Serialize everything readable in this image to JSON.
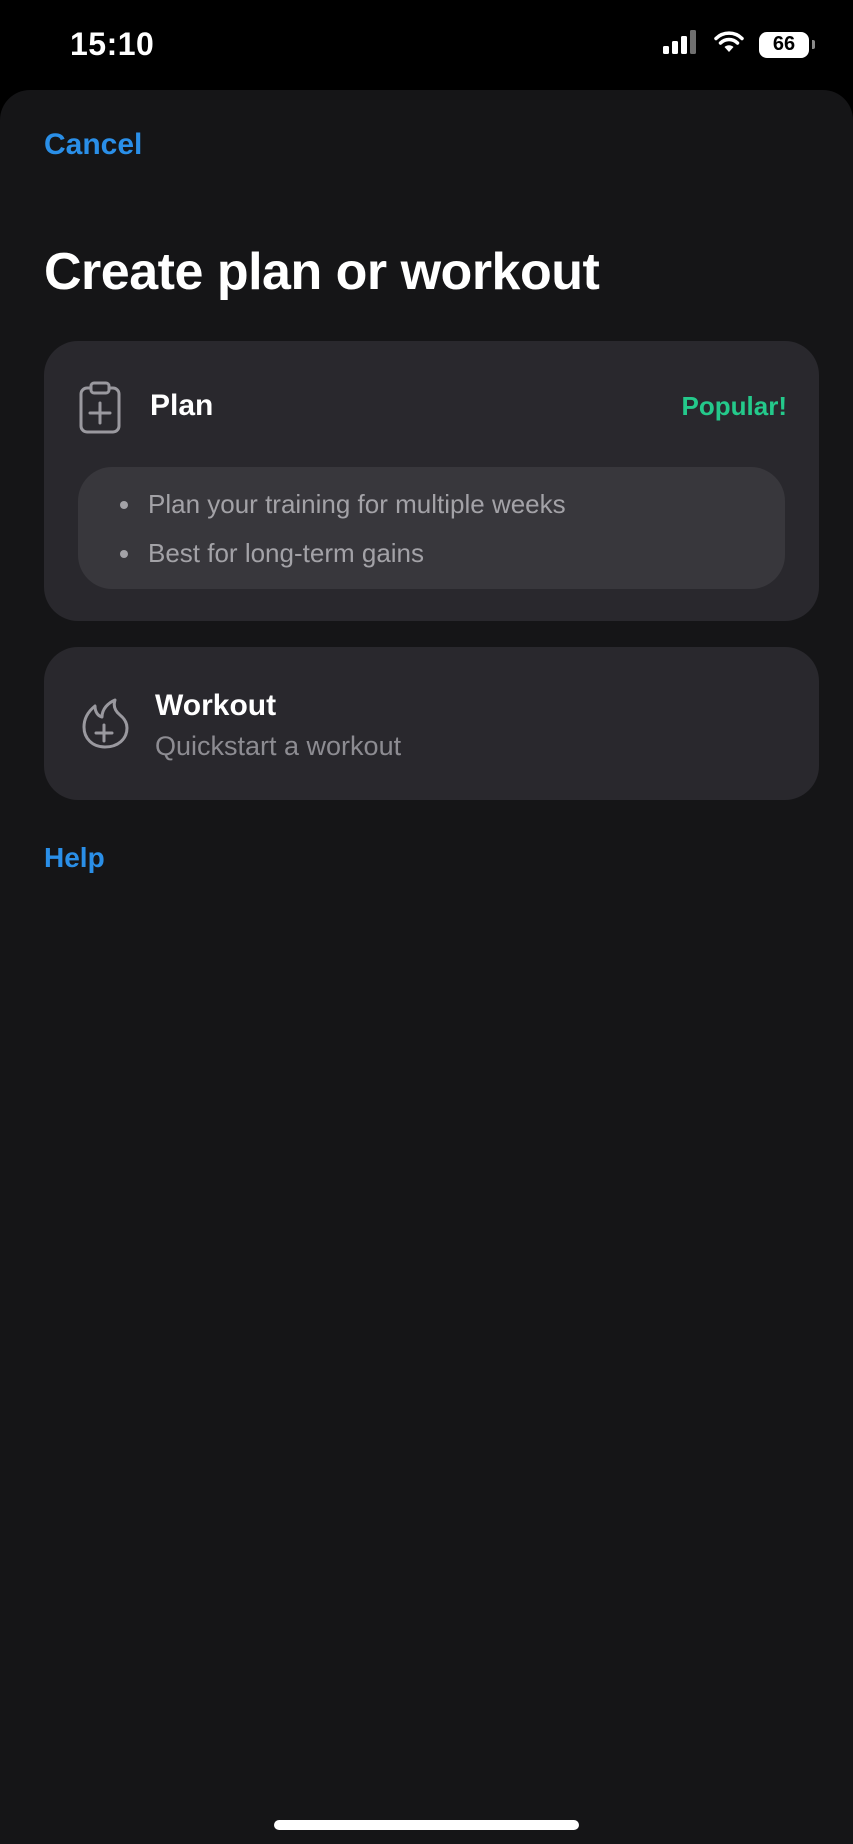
{
  "status_bar": {
    "time": "15:10",
    "battery_level": "66",
    "signal_icon": "cellular-signal-icon",
    "wifi_icon": "wifi-icon"
  },
  "header": {
    "cancel_label": "Cancel",
    "title": "Create plan or workout"
  },
  "plan_option": {
    "icon": "clipboard-plus-icon",
    "title": "Plan",
    "badge": "Popular!",
    "bullets": [
      "Plan your training for multiple weeks",
      "Best for long-term gains"
    ]
  },
  "workout_option": {
    "icon": "flame-plus-icon",
    "title": "Workout",
    "subtitle": "Quickstart a workout"
  },
  "footer": {
    "help_label": "Help"
  },
  "colors": {
    "accent_blue": "#2a8fe8",
    "popular_green": "#24c98b",
    "sheet_bg": "#151517",
    "card_bg": "#29282d"
  }
}
